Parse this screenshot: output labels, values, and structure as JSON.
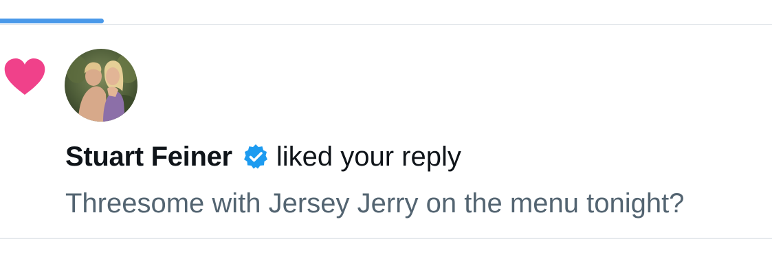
{
  "notification": {
    "type_icon": "heart-icon",
    "user": {
      "name": "Stuart Feiner",
      "verified": true,
      "verified_icon": "verified-badge-icon",
      "avatar": "avatar-photo"
    },
    "action": "liked your reply",
    "reply_text": "Threesome with Jersey Jerry on the menu tonight?"
  },
  "colors": {
    "heart": "#f0418a",
    "verified": "#1d9bf0",
    "tab_indicator": "#4a99e9",
    "primary_text": "#0f1419",
    "secondary_text": "#536471",
    "divider": "#e1e6ea"
  }
}
